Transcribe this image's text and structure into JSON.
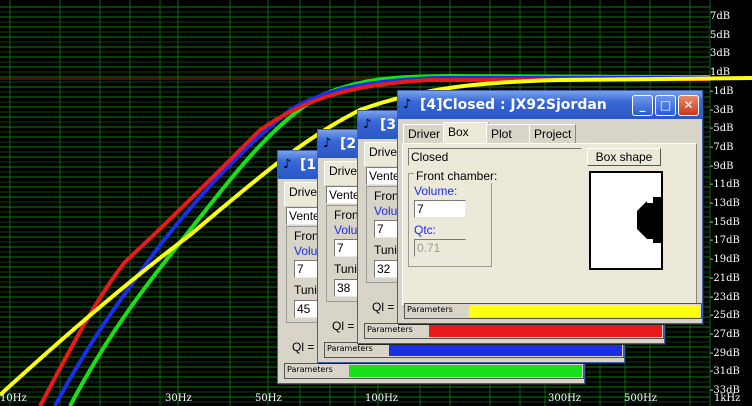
{
  "colors": {
    "grid": "#0f7d0f",
    "ref_line": "#b01010",
    "green": "#18e018",
    "blue": "#1a2ee8",
    "red": "#e81a1a",
    "yellow": "#ffff10",
    "title_bar": "#2a57c4",
    "window_bg": "#d8d4c8"
  },
  "db_ticks": [
    "7dB",
    "5dB",
    "3dB",
    "1dB",
    "-1dB",
    "-3dB",
    "-5dB",
    "-7dB",
    "-9dB",
    "-11dB",
    "-13dB",
    "-15dB",
    "-17dB",
    "-19dB",
    "-21dB",
    "-23dB",
    "-25dB",
    "-27dB",
    "-29dB",
    "-31dB",
    "-33dB"
  ],
  "hz_ticks": [
    "10Hz",
    "30Hz",
    "50Hz",
    "100Hz",
    "300Hz",
    "500Hz",
    "1kHz"
  ],
  "windows": [
    {
      "title": "[1]",
      "tab0": "Driver",
      "field_combo": "Vente",
      "group": "Fron",
      "vol_label": "Volu",
      "vol": "7",
      "tune_label": "Tuni",
      "tune": "45",
      "ql": "Ql = 7",
      "status": "Parameters",
      "swatch": "green"
    },
    {
      "title": "[2]",
      "tab0": "Driver",
      "field_combo": "Vente",
      "group": "Fron",
      "vol_label": "Volu",
      "vol": "7",
      "tune_label": "Tuni",
      "tune": "38",
      "ql": "Ql = 7",
      "status": "Parameters",
      "swatch": "blue"
    },
    {
      "title": "[3]",
      "tab0": "Driver",
      "field_combo": "Vente",
      "group": "Fron",
      "vol_label": "Volu",
      "vol": "7",
      "tune_label": "Tuni",
      "tune": "32",
      "ql": "Ql = 7",
      "status": "Parameters",
      "swatch": "red"
    }
  ],
  "front": {
    "title": "[4]Closed : JX92Sjordan",
    "tabs": [
      "Driver",
      "Box",
      "Plot",
      "Project"
    ],
    "box_type": "Closed",
    "box_shape_button": "Box shape",
    "group": "Front chamber:",
    "volume_label": "Volume:",
    "volume": "7",
    "qtc_label": "Qtc:",
    "qtc": "0.71",
    "status": "Parameters",
    "swatch": "yellow"
  }
}
